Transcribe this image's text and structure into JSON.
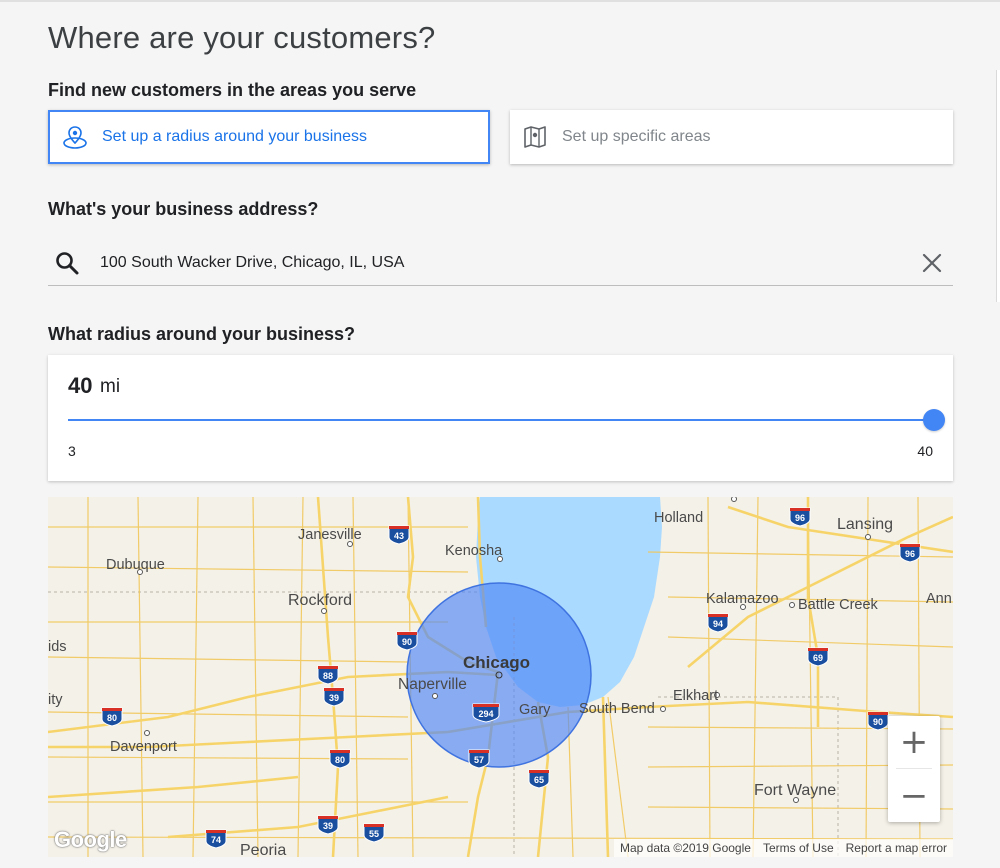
{
  "page": {
    "title": "Where are your customers?",
    "find_heading": "Find new customers in the areas you serve",
    "address_heading": "What's your business address?",
    "radius_heading": "What radius around your business?"
  },
  "options": {
    "radius_label": "Set up a radius around your business",
    "areas_label": "Set up specific areas",
    "selected": "radius"
  },
  "address": {
    "value": "100 South Wacker Drive, Chicago, IL, USA"
  },
  "radius": {
    "value": "40",
    "unit": "mi",
    "min": "3",
    "max": "40",
    "fraction": 1.0
  },
  "map": {
    "cities": [
      "Janesville",
      "Kenosha",
      "Holland",
      "Lansing",
      "Dubuque",
      "Rockford",
      "Kalamazoo",
      "Battle Creek",
      "Ann",
      "ids",
      "Chicago",
      "Naperville",
      "Elkhart",
      "ity",
      "Gary",
      "South Bend",
      "Davenport",
      "Fort Wayne",
      "Peoria"
    ],
    "highways": [
      "43",
      "96",
      "96",
      "94",
      "90",
      "69",
      "88",
      "39",
      "80",
      "294",
      "57",
      "80",
      "65",
      "90",
      "74",
      "39",
      "55"
    ],
    "attribution": "Map data ©2019 Google",
    "terms": "Terms of Use",
    "report": "Report a map error",
    "logo": "Google",
    "zoom_in": "+",
    "zoom_out": "−"
  },
  "colors": {
    "accent": "#4285f4",
    "water": "#aadaff",
    "land": "#f4f1e8",
    "road": "#f7d46a",
    "radius_fill": "#4f86f7"
  }
}
